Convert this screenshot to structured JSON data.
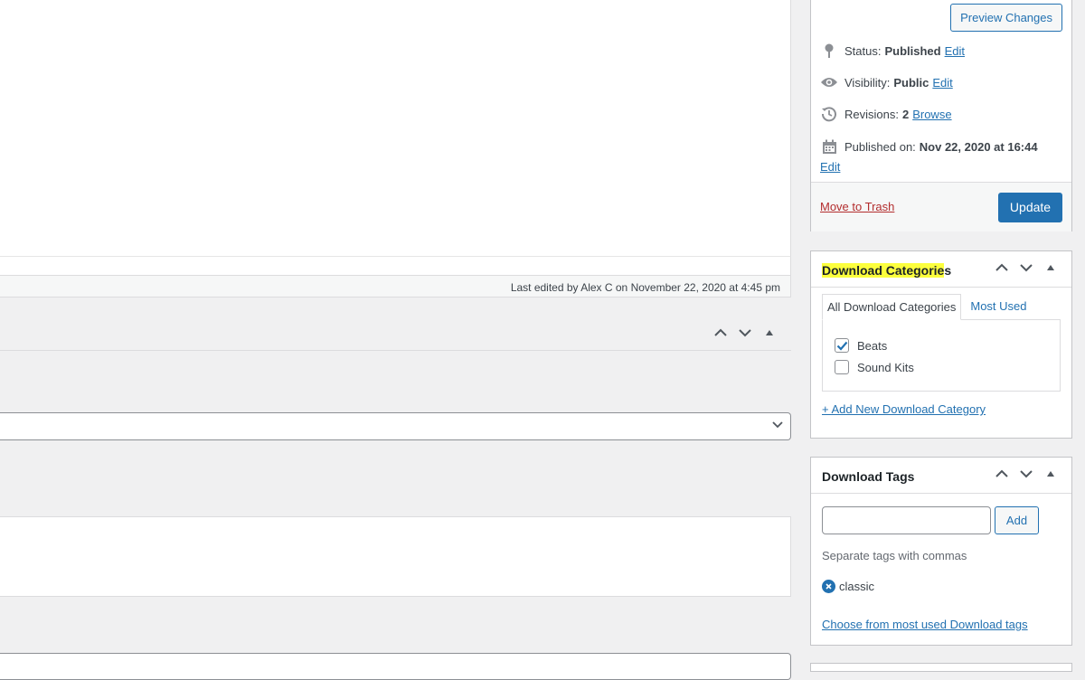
{
  "editor": {
    "last_edited": "Last edited by Alex C on November 22, 2020 at 4:45 pm"
  },
  "publish": {
    "preview_label": "Preview Changes",
    "status_label": "Status:",
    "status_value": "Published",
    "status_edit": "Edit",
    "visibility_label": "Visibility:",
    "visibility_value": "Public",
    "visibility_edit": "Edit",
    "revisions_label": "Revisions:",
    "revisions_value": "2",
    "revisions_browse": "Browse",
    "published_on_label": "Published on:",
    "published_on_value": "Nov 22, 2020 at 16:44",
    "published_on_edit": "Edit",
    "trash_label": "Move to Trash",
    "update_label": "Update"
  },
  "categories": {
    "title_highlighted": "Download Categorie",
    "title_rest": "s",
    "tab_all": "All Download Categories",
    "tab_most_used": "Most Used",
    "items": [
      {
        "label": "Beats",
        "checked": true
      },
      {
        "label": "Sound Kits",
        "checked": false
      }
    ],
    "add_new": "+ Add New Download Category"
  },
  "tags": {
    "title": "Download Tags",
    "input_value": "",
    "add_label": "Add",
    "help": "Separate tags with commas",
    "items": [
      "classic"
    ],
    "most_used_link": "Choose from most used Download tags"
  },
  "colors": {
    "accent": "#2271b1",
    "highlight": "#fcff3d",
    "trash": "#b32d2e"
  }
}
